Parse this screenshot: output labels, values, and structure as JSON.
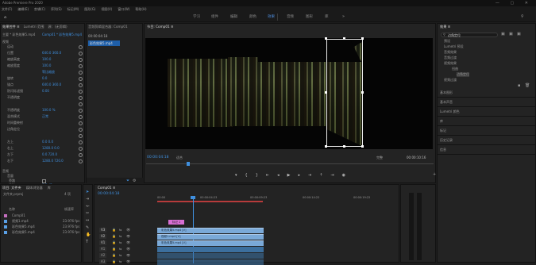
{
  "window": {
    "title": "Adobe Premiere Pro 2020",
    "controls": "— ▢ ✕"
  },
  "menu": [
    "文件(F)",
    "编辑(E)",
    "剪辑(C)",
    "序列(S)",
    "标记(M)",
    "图形(G)",
    "视图(V)",
    "窗口(W)",
    "帮助(H)"
  ],
  "workspaces": [
    "学习",
    "组件",
    "编辑",
    "颜色",
    "效果",
    "音频",
    "图形",
    "库"
  ],
  "active_workspace": "效果",
  "effect_controls": {
    "tabs": [
      "效果控件 ≡",
      "Lumetri 范围",
      "源：(无剪辑)",
      "音频剪辑混合器：Comp01"
    ],
    "source": "主要 * 彩色效果5.mp4",
    "sequence": "Comp01 * 彩色效果5.mp4",
    "section_video": "视频",
    "rows": [
      {
        "label": "运动",
        "value": ""
      },
      {
        "label": "位置",
        "value": "640.0   360.0"
      },
      {
        "label": "缩放高度",
        "value": "100.0"
      },
      {
        "label": "缩放宽度",
        "value": "100.0"
      },
      {
        "label": "",
        "value": "等比缩放"
      },
      {
        "label": "旋转",
        "value": "0.0"
      },
      {
        "label": "锚点",
        "value": "640.0   360.0"
      },
      {
        "label": "防闪烁滤镜",
        "value": "0.00"
      },
      {
        "label": "不透明度",
        "value": ""
      },
      {
        "label": "",
        "value": ""
      },
      {
        "label": "不透明度",
        "value": "100.0 %"
      },
      {
        "label": "混合模式",
        "value": "正常"
      },
      {
        "label": "时间重映射",
        "value": ""
      },
      {
        "label": "边角定位",
        "value": ""
      },
      {
        "label": "",
        "value": ""
      },
      {
        "label": "左上",
        "value": "0.0      0.0"
      },
      {
        "label": "右上",
        "value": "1280.0   0.0"
      },
      {
        "label": "左下",
        "value": "0.0    720.0"
      },
      {
        "label": "右下",
        "value": "1280.0 720.0"
      }
    ],
    "section_audio": "音频",
    "audio_rows": [
      {
        "label": "音量",
        "value": ""
      },
      {
        "label": "旁路",
        "value": ""
      },
      {
        "label": "级别",
        "value": "0.0 dB"
      }
    ],
    "footer_time": "00:00:04:18"
  },
  "project": {
    "tabs": [
      "项目: 文件夹",
      "媒体浏览器",
      "库"
    ],
    "path": "文件夹.prproj",
    "count": "4 项",
    "col_name": "名称",
    "col_rate": "帧速率",
    "items": [
      {
        "name": "Comp01",
        "rate": "",
        "color": "#c46fbf"
      },
      {
        "name": "视频1.mp4",
        "rate": "23.976 fps",
        "color": "#5aa0e6"
      },
      {
        "name": "彩色效果5.mp4",
        "rate": "23.976 fps",
        "color": "#5aa0e6"
      },
      {
        "name": "彩色效果5.mp4",
        "rate": "23.976 fps",
        "color": "#5aa0e6"
      }
    ]
  },
  "source_mini": {
    "tab": "音频剪辑混合器: Comp01",
    "clip": "彩色效果5.mp4",
    "timecode": "00:00:04:18"
  },
  "program": {
    "title": "节目: Comp01 ≡",
    "timecode": "00:00:04:18",
    "fit": "适合",
    "quality": "完整",
    "duration": "00:00:10:16"
  },
  "timeline": {
    "tab": "Comp01 ≡",
    "timecode": "00:00:04:18",
    "ruler": [
      "00:00",
      "00:00:04:23",
      "00:00:09:23",
      "00:00:14:22",
      "00:00:19:22"
    ],
    "tracks": [
      "V3",
      "V2",
      "V1",
      "A1",
      "A2",
      "A3"
    ],
    "clips": [
      {
        "label": "彩色效果5.mp4 [V]",
        "track": "V3"
      },
      {
        "label": "视频1.mp4 [V]",
        "track": "V2"
      },
      {
        "label": "彩色效果5.mp4 [V]",
        "track": "V1"
      }
    ],
    "marker": "标记 1"
  },
  "effects": {
    "title": "效果 ≡",
    "search": "边角定位",
    "tree": [
      "预设",
      "Lumetri 预设",
      "音频效果",
      "音频过渡",
      "视频效果",
      "扭曲",
      "边角定位",
      "视频过渡"
    ],
    "panels": [
      "基本图形",
      "基本声音",
      "Lumetri 颜色",
      "库",
      "标记",
      "历史记录",
      "信息"
    ]
  }
}
